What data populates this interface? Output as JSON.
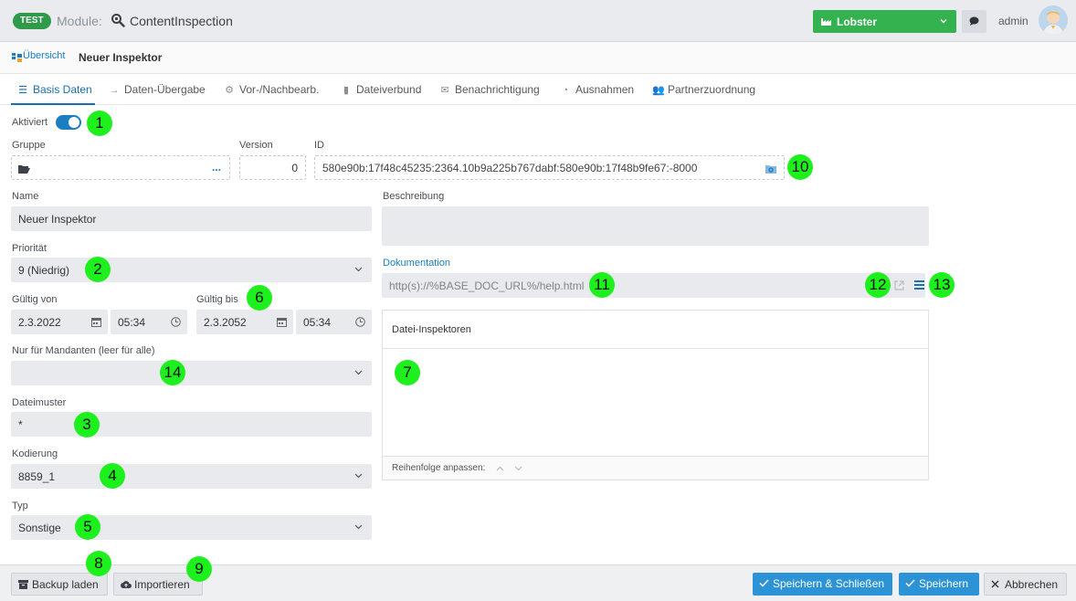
{
  "header": {
    "env_badge": "TEST",
    "module_label": "Module:",
    "module_name": "ContentInspection",
    "tenant": "Lobster",
    "user": "admin"
  },
  "breadcrumb": {
    "link": "Übersicht",
    "current": "Neuer Inspektor"
  },
  "tabs": [
    {
      "label": "Basis Daten",
      "icon": "list-icon",
      "active": true
    },
    {
      "label": "Daten-Übergabe",
      "icon": "arrow-right-icon"
    },
    {
      "label": "Vor-/Nachbearb.",
      "icon": "gears-icon"
    },
    {
      "label": "Dateiverbund",
      "icon": "file-icon"
    },
    {
      "label": "Benachrichtigung",
      "icon": "envelope-icon"
    },
    {
      "label": "Ausnahmen",
      "icon": "clock-icon"
    },
    {
      "label": "Partnerzuordnung",
      "icon": "users-icon"
    }
  ],
  "form": {
    "activated_label": "Aktiviert",
    "activated": true,
    "group_label": "Gruppe",
    "group_dots": "...",
    "version_label": "Version",
    "version_value": "0",
    "id_label": "ID",
    "id_value": "580e90b:17f48c45235:2364.10b9a225b767dabf:580e90b:17f48b9fe67:-8000",
    "name_label": "Name",
    "name_value": "Neuer Inspektor",
    "description_label": "Beschreibung",
    "description_value": "",
    "priority_label": "Priorität",
    "priority_value": "9 (Niedrig)",
    "documentation_label": "Dokumentation",
    "documentation_value": "http(s)://%BASE_DOC_URL%/help.html",
    "valid_from_label": "Gültig von",
    "valid_from_date": "2.3.2022",
    "valid_from_time": "05:34",
    "valid_to_label": "Gültig bis",
    "valid_to_date": "2.3.2052",
    "valid_to_time": "05:34",
    "clients_label": "Nur für Mandanten (leer für alle)",
    "clients_value": "",
    "filepattern_label": "Dateimuster",
    "filepattern_value": "*",
    "encoding_label": "Kodierung",
    "encoding_value": "8859_1",
    "type_label": "Typ",
    "type_value": "Sonstige"
  },
  "file_inspectors": {
    "title": "Datei-Inspektoren",
    "reorder_label": "Reihenfolge anpassen:"
  },
  "markers": [
    "1",
    "2",
    "3",
    "4",
    "5",
    "6",
    "7",
    "8",
    "9",
    "10",
    "11",
    "12",
    "13",
    "14"
  ],
  "footer": {
    "backup_label": "Backup laden",
    "import_label": "Importieren",
    "save_close_label": "Speichern & Schließen",
    "save_label": "Speichern",
    "cancel_label": "Abbrechen"
  },
  "colors": {
    "accent": "#1b7ec2",
    "tenant_green": "#34b24f",
    "badge_green": "#2e9a4a",
    "button_blue": "#2b93d6",
    "marker_green": "#1ef01e"
  }
}
